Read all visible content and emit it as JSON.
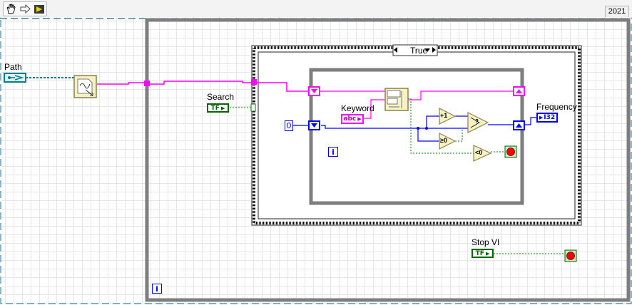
{
  "toolbar": {
    "tools": [
      {
        "name": "operate-hand-icon",
        "glyph": "✋"
      },
      {
        "name": "run-arrow-icon",
        "glyph": "⇨"
      },
      {
        "name": "highlight-execution-icon",
        "glyph": "▶"
      }
    ],
    "version_label": "2021"
  },
  "controls": {
    "path_label": "Path",
    "search_label": "Search",
    "search_terminal": "TF",
    "keyword_label": "Keyword",
    "keyword_terminal": "abc",
    "frequency_label": "Frequency",
    "frequency_terminal": "I32",
    "stop_label": "Stop VI",
    "stop_terminal": "TF",
    "constant_zero": "0"
  },
  "structures": {
    "case_selector": "True",
    "outer_loop_iteration": "i",
    "inner_loop_iteration": "i"
  },
  "nodes": {
    "increment": "+1",
    "greater_equal_zero": "≥0",
    "less_than_zero": "<0",
    "select": "?"
  },
  "colors": {
    "boolean_wire": "#008000",
    "string_wire": "#ff00ff",
    "integer_wire": "#0000ff",
    "path_wire": "#00808a",
    "structure_border": "#7e7e7e"
  }
}
